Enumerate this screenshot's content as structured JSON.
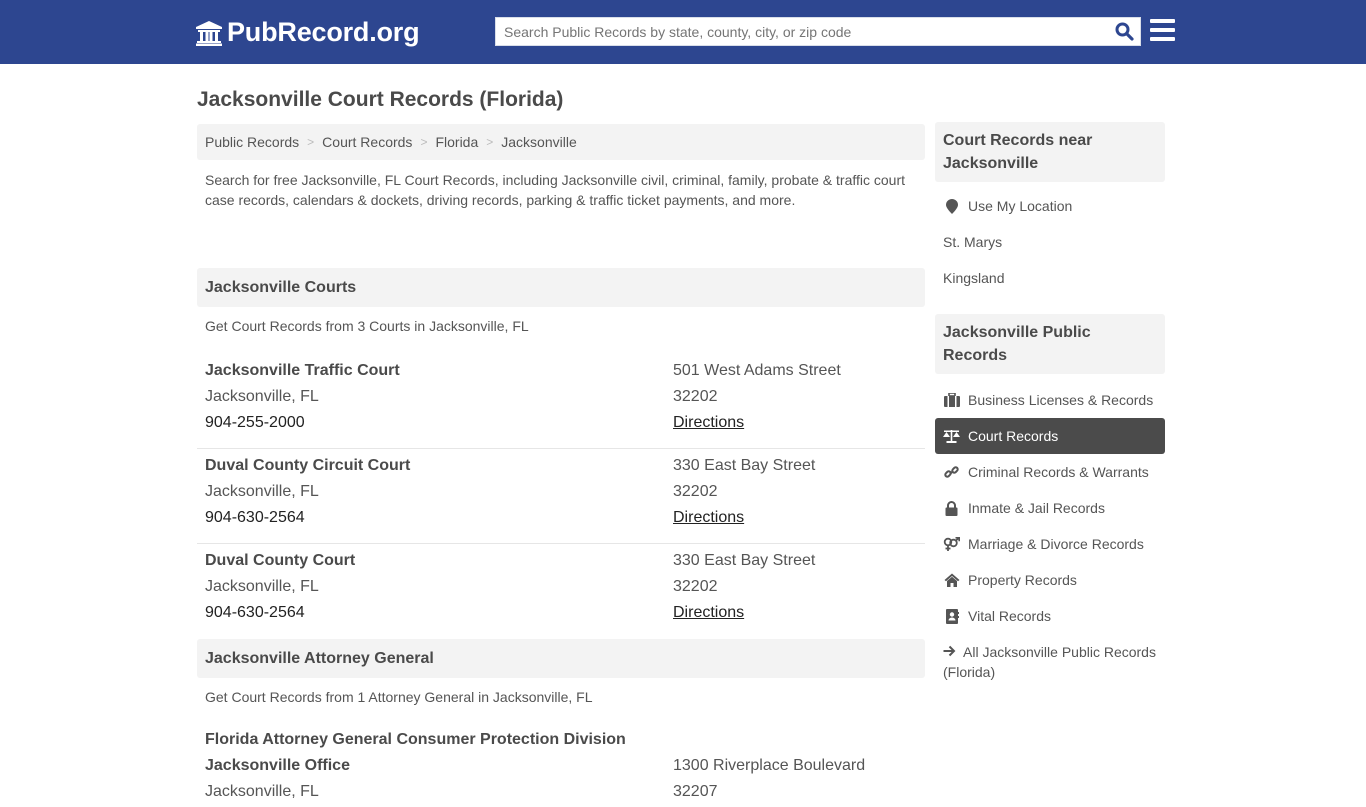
{
  "header": {
    "logo_text": "PubRecord.org",
    "logo_icon": "bank-building-icon",
    "search_placeholder": "Search Public Records by state, county, city, or zip code",
    "search_value": "",
    "brand_color": "#2d4690"
  },
  "page": {
    "title": "Jacksonville Court Records (Florida)"
  },
  "breadcrumb": [
    {
      "label": "Public Records"
    },
    {
      "label": "Court Records"
    },
    {
      "label": "Florida"
    },
    {
      "label": "Jacksonville"
    }
  ],
  "breadcrumb_separator": ">",
  "intro": "Search for free Jacksonville, FL Court Records, including Jacksonville civil, criminal, family, probate & traffic court case records, calendars & dockets, driving records, parking & traffic ticket payments, and more.",
  "courts_section": {
    "heading": "Jacksonville Courts",
    "subheading": "Get Court Records from 3 Courts in Jacksonville, FL",
    "courts": [
      {
        "name": "Jacksonville Traffic Court",
        "city": "Jacksonville, FL",
        "phone": "904-255-2000",
        "address": "501 West Adams Street",
        "zip": "32202",
        "directions": "Directions"
      },
      {
        "name": "Duval County Circuit Court",
        "city": "Jacksonville, FL",
        "phone": "904-630-2564",
        "address": "330 East Bay Street",
        "zip": "32202",
        "directions": "Directions"
      },
      {
        "name": "Duval County Court",
        "city": "Jacksonville, FL",
        "phone": "904-630-2564",
        "address": "330 East Bay Street",
        "zip": "32202",
        "directions": "Directions"
      }
    ]
  },
  "ag_section": {
    "heading": "Jacksonville Attorney General",
    "subheading": "Get Court Records from 1 Attorney General in Jacksonville, FL",
    "office": {
      "name_line1": "Florida Attorney General Consumer Protection Division",
      "name_line2": "Jacksonville Office",
      "city": "Jacksonville, FL",
      "address": "1300 Riverplace Boulevard",
      "zip": "32207"
    }
  },
  "sidebar": {
    "near_heading": "Court Records near Jacksonville",
    "near_items": [
      {
        "label": "Use My Location",
        "icon": "map-marker-icon"
      },
      {
        "label": "St. Marys"
      },
      {
        "label": "Kingsland"
      }
    ],
    "records_heading": "Jacksonville Public Records",
    "records_items": [
      {
        "label": "Business Licenses & Records",
        "icon": "briefcase-icon",
        "active": false
      },
      {
        "label": "Court Records",
        "icon": "balance-scale-icon",
        "active": true
      },
      {
        "label": "Criminal Records & Warrants",
        "icon": "link-icon",
        "active": false
      },
      {
        "label": "Inmate & Jail Records",
        "icon": "lock-icon",
        "active": false
      },
      {
        "label": "Marriage & Divorce Records",
        "icon": "venus-mars-icon",
        "active": false
      },
      {
        "label": "Property Records",
        "icon": "home-icon",
        "active": false
      },
      {
        "label": "Vital Records",
        "icon": "address-book-icon",
        "active": false
      }
    ],
    "all_link": "All Jacksonville Public Records (Florida)",
    "all_link_icon": "arrow-right-icon",
    "active_color": "#4b4b4b"
  }
}
